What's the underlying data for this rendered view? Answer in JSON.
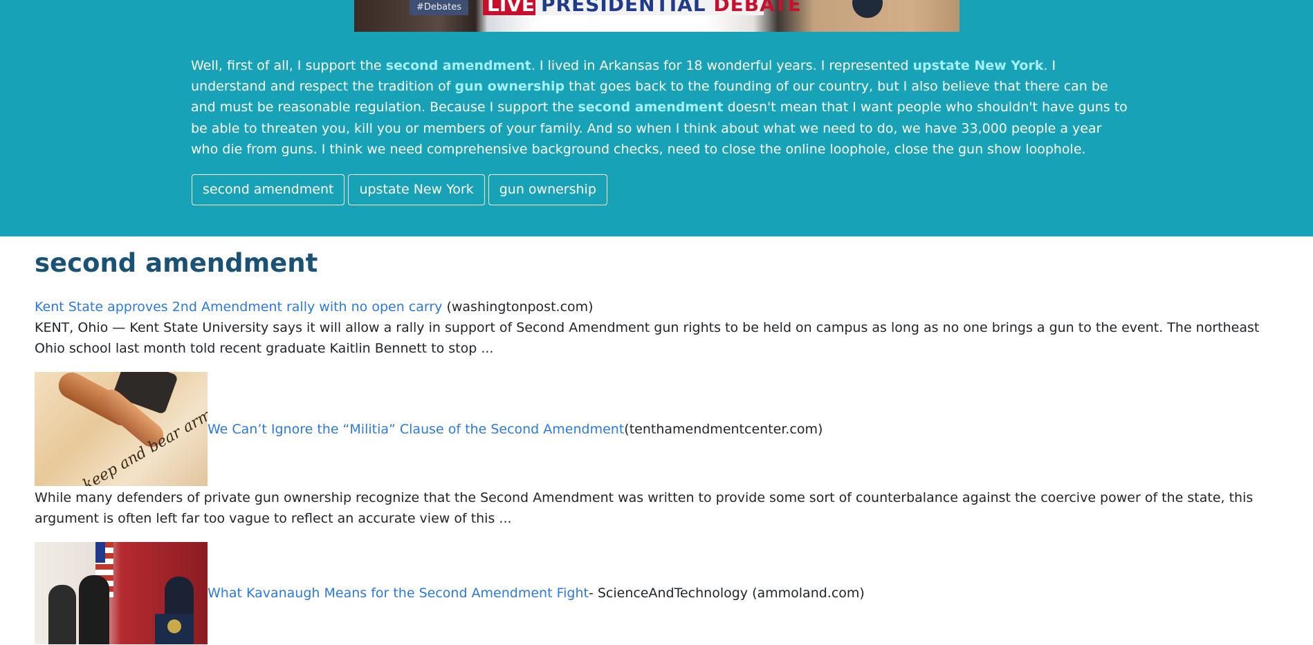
{
  "video": {
    "badge": "#Debates",
    "live": "LIVE",
    "title_main": "PRESIDENTIAL",
    "title_accent": "DEBATE"
  },
  "transcript": {
    "seg0": "Well, first of all, I support the ",
    "hl0": "second amendment",
    "seg1": ". I lived in Arkansas for 18 wonderful years. I represented ",
    "hl1": "upstate New York",
    "seg2": ". I understand and respect the tradition of ",
    "hl2": "gun ownership",
    "seg3": " that goes back to the founding of our country, but I also believe that there can be and must be reasonable regulation. Because I support the ",
    "hl3": "second amendment",
    "seg4": " doesn't mean that I want people who shouldn't have guns to be able to threaten you, kill you or members of your family. And so when I think about what we need to do, we have 33,000 people a year who die from guns. I think we need comprehensive background checks, need to close the online loophole, close the gun show loophole."
  },
  "topics": [
    "second amendment",
    "upstate New York",
    "gun ownership"
  ],
  "section": {
    "title": "second amendment",
    "articles": [
      {
        "title": "Kent State approves 2nd Amendment rally with no open carry",
        "source": " (washingtonpost.com)",
        "snippet": "KENT, Ohio — Kent State University says it will allow a rally in support of Second Amendment gun rights to be held on campus as long as no one brings a gun to the event. The northeast Ohio school last month told recent graduate Kaitlin Bennett to stop ..."
      },
      {
        "title": "We Can’t Ignore the “Militia” Clause of the Second Amendment",
        "source": " (tenthamendmentcenter.com)",
        "snippet": "While many defenders of private gun ownership recognize that the Second Amendment was written to provide some sort of counterbalance against the coercive power of the state, this argument is often left far too vague to reflect an accurate view of this ..."
      },
      {
        "title": "What Kavanaugh Means for the Second Amendment Fight",
        "source": " - ScienceAndTechnology (ammoland.com)"
      }
    ]
  }
}
